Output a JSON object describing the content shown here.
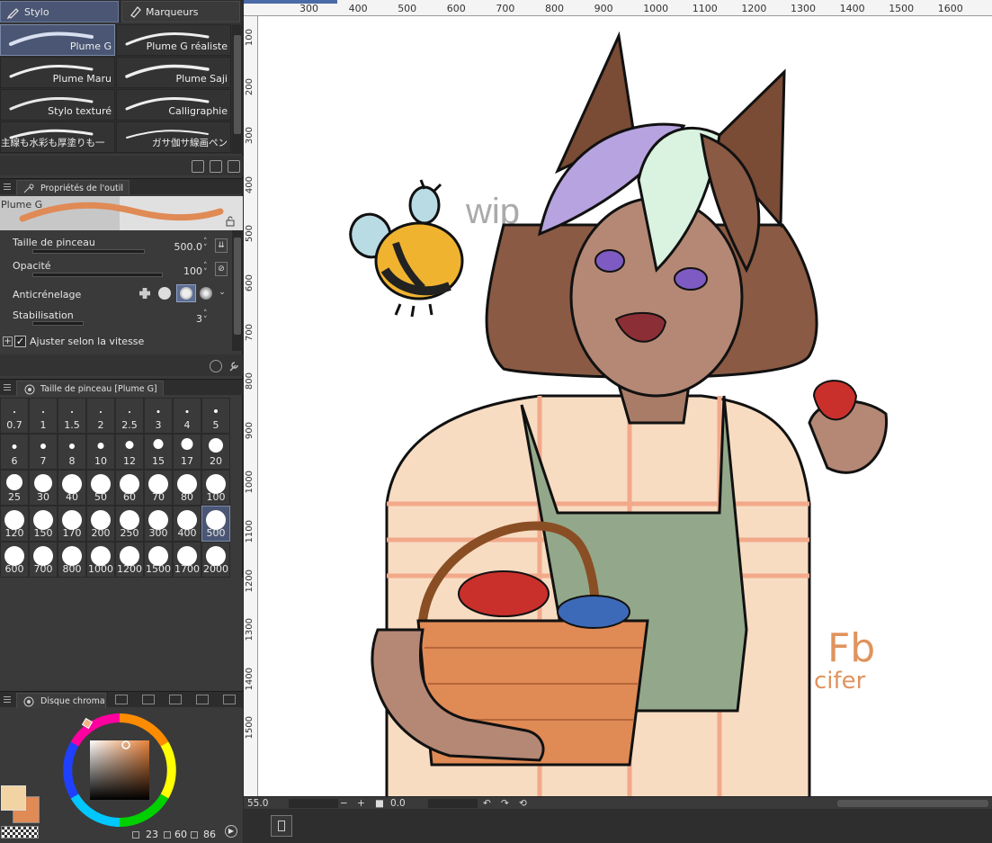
{
  "tabs": {
    "pen": "Stylo",
    "marker": "Marqueurs"
  },
  "brushes": [
    {
      "label": "Plume G",
      "selected": true
    },
    {
      "label": "Plume G réaliste",
      "selected": false
    },
    {
      "label": "Plume Maru",
      "selected": false
    },
    {
      "label": "Plume Saji",
      "selected": false
    },
    {
      "label": "Stylo texturé",
      "selected": false
    },
    {
      "label": "Calligraphie",
      "selected": false
    },
    {
      "label": "主線も水彩も厚塗りも一",
      "selected": false
    },
    {
      "label": "ガサ伽サ線画ペン",
      "selected": false
    }
  ],
  "tool_properties": {
    "panel_title": "Propriétés de l'outil",
    "brush_name": "Plume G",
    "stroke_color": "#e08a55",
    "brush_size_label": "Taille de pinceau",
    "brush_size_value": "500.0",
    "opacity_label": "Opacité",
    "opacity_value": "100",
    "antialias_label": "Anticrénelage",
    "stabilization_label": "Stabilisation",
    "stabilization_value": "3",
    "adjust_speed_label": "Ajuster selon la vitesse"
  },
  "brush_size_panel": {
    "title": "Taille de pinceau [Plume G]",
    "sizes": [
      "0.7",
      "1",
      "1.5",
      "2",
      "2.5",
      "3",
      "4",
      "5",
      "6",
      "7",
      "8",
      "10",
      "12",
      "15",
      "17",
      "20",
      "25",
      "30",
      "40",
      "50",
      "60",
      "70",
      "80",
      "100",
      "120",
      "150",
      "170",
      "200",
      "250",
      "300",
      "400",
      "500",
      "600",
      "700",
      "800",
      "1000",
      "1200",
      "1500",
      "1700",
      "2000"
    ],
    "selected": "500"
  },
  "color_panel": {
    "title": "Disque chromati",
    "main_color": "#f2d3a3",
    "sub_color": "#e08a55",
    "values": [
      "23",
      "60",
      "86"
    ]
  },
  "ruler_top": [
    "300",
    "400",
    "500",
    "600",
    "700",
    "800",
    "900",
    "1000",
    "1100",
    "1200",
    "1300",
    "1400",
    "1500",
    "1600"
  ],
  "ruler_left": [
    "100",
    "200",
    "300",
    "400",
    "500",
    "600",
    "700",
    "800",
    "900",
    "1000",
    "1100",
    "1200",
    "1300",
    "1400",
    "1500"
  ],
  "canvas": {
    "wip_text": "wip",
    "signature_top": "Fb",
    "signature_bottom": "cifer"
  },
  "status": {
    "zoom": "55.0",
    "rotation": "0.0"
  }
}
